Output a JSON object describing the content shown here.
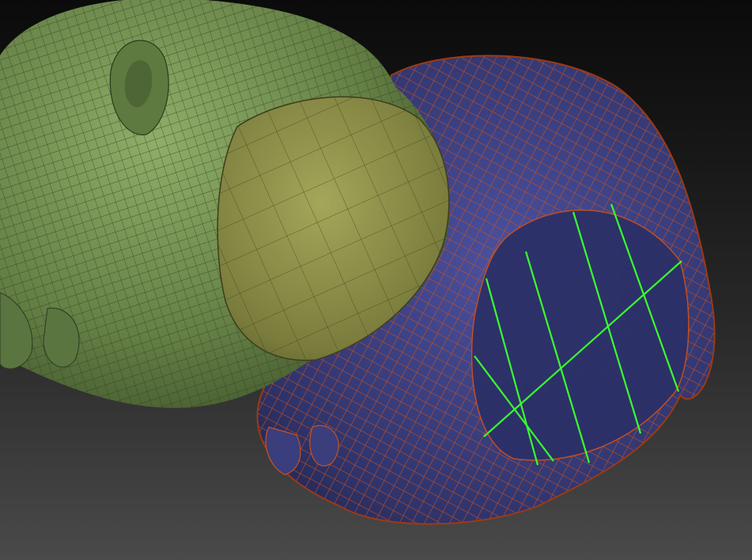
{
  "viewport": {
    "background_top": "#0b0b0b",
    "background_bottom": "#4a4a4a"
  },
  "models": [
    {
      "name": "green-head",
      "surface_color": "#6e8a4e",
      "wire_color": "#2b3a1c",
      "shaded_patch_color": "#8a8f4a"
    },
    {
      "name": "blue-head",
      "surface_color": "#3b3f7a",
      "wire_color": "#c0481c"
    },
    {
      "name": "selection-grid",
      "line_color": "#39ff2e"
    }
  ]
}
